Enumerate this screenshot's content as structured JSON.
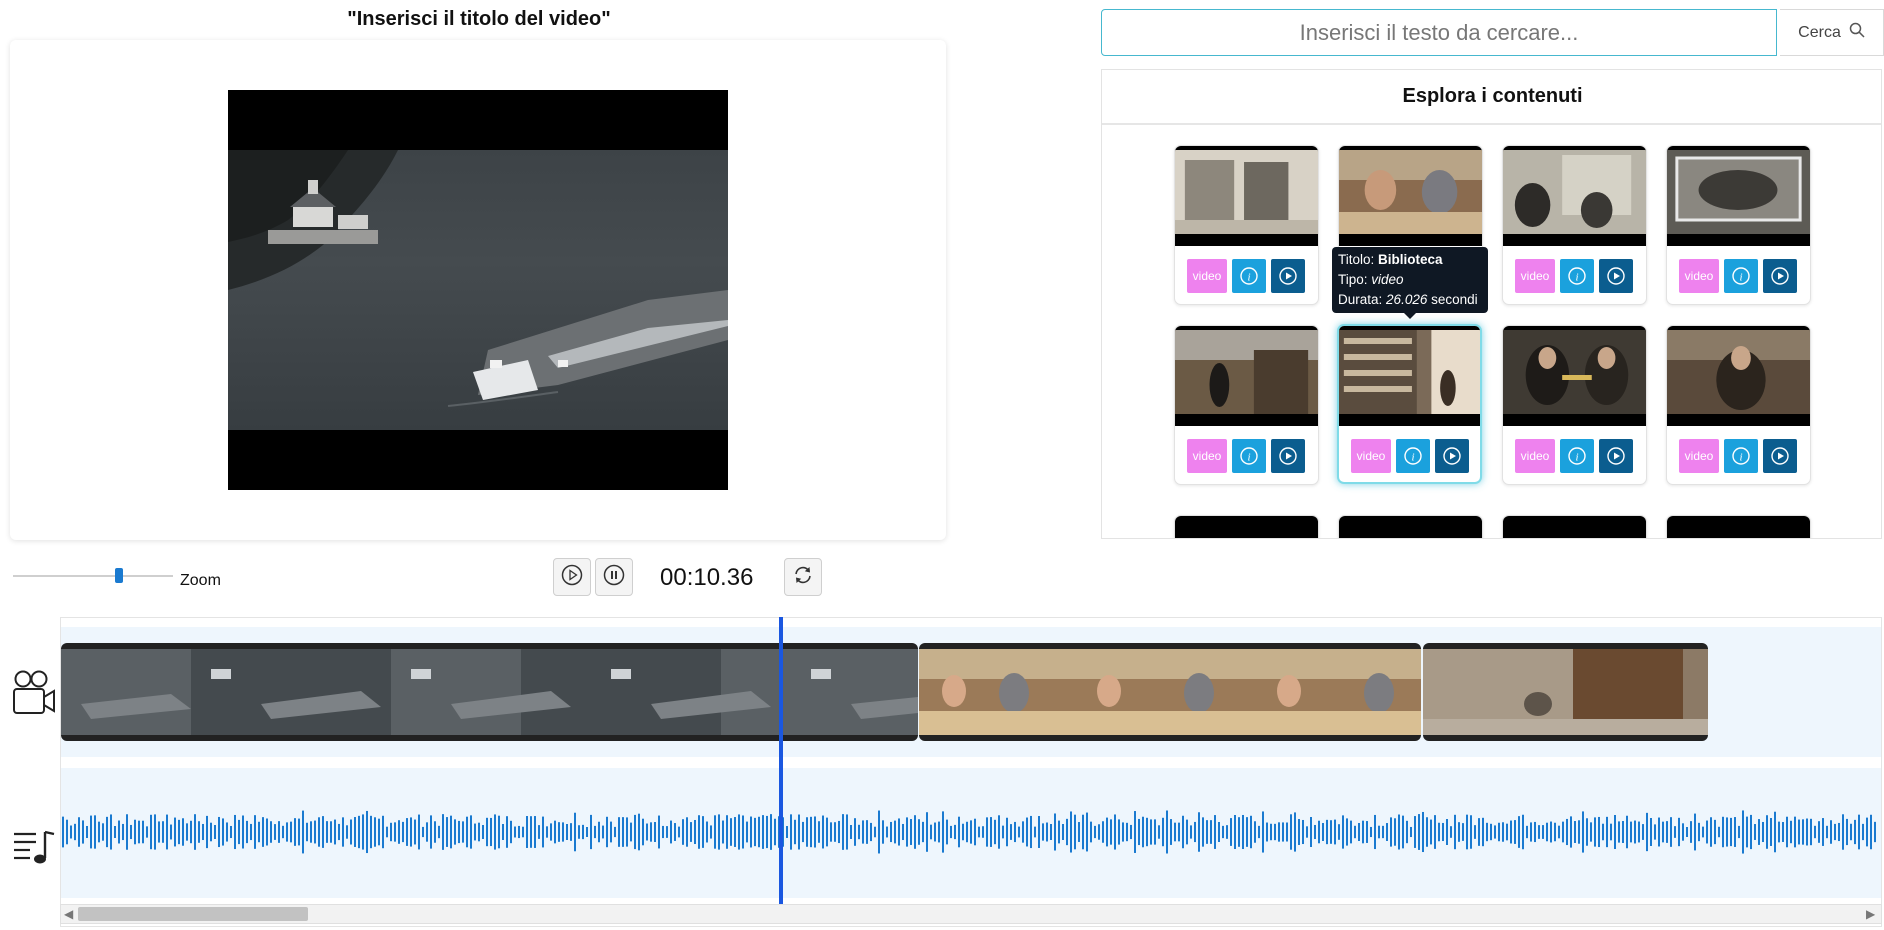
{
  "editor": {
    "video_title": "\"Inserisci il titolo del video\""
  },
  "search": {
    "placeholder": "Inserisci il testo da cercare...",
    "button_label": "Cerca",
    "button_icon": "search-icon"
  },
  "explorer": {
    "title": "Esplora i contenuti",
    "cards": [
      {
        "type_label": "video",
        "thumb_color": "#d8d2c6"
      },
      {
        "type_label": "video",
        "thumb_color": "#8a6b4f"
      },
      {
        "type_label": "video",
        "thumb_color": "#b8b4a8"
      },
      {
        "type_label": "video",
        "thumb_color": "#5d5b55"
      },
      {
        "type_label": "video",
        "thumb_color": "#6b5a45"
      },
      {
        "type_label": "video",
        "thumb_color": "#7b6a58"
      },
      {
        "type_label": "video",
        "thumb_color": "#3f3a33"
      },
      {
        "type_label": "video",
        "thumb_color": "#5a4a3b"
      }
    ],
    "tooltip": {
      "title_label": "Titolo:",
      "title_value": "Biblioteca",
      "type_label": "Tipo:",
      "type_value": "video",
      "duration_label": "Durata:",
      "duration_value": "26.026",
      "duration_unit": "secondi"
    }
  },
  "controls": {
    "zoom_label": "Zoom",
    "zoom_level": 0.65,
    "timecode": "00:10.36",
    "play_icon": "play-icon",
    "pause_icon": "pause-icon",
    "refresh_icon": "refresh-icon"
  },
  "timeline": {
    "video_track_icon": "video-camera-icon",
    "audio_track_icon": "music-playlist-icon",
    "clips": [
      {
        "name": "clip-river",
        "color": "#454b4f"
      },
      {
        "name": "clip-library",
        "color": "#9b7a58"
      },
      {
        "name": "clip-street",
        "color": "#8c7a66"
      }
    ],
    "accent_color": "#1a57e0",
    "waveform_color": "#1a7ad0"
  }
}
